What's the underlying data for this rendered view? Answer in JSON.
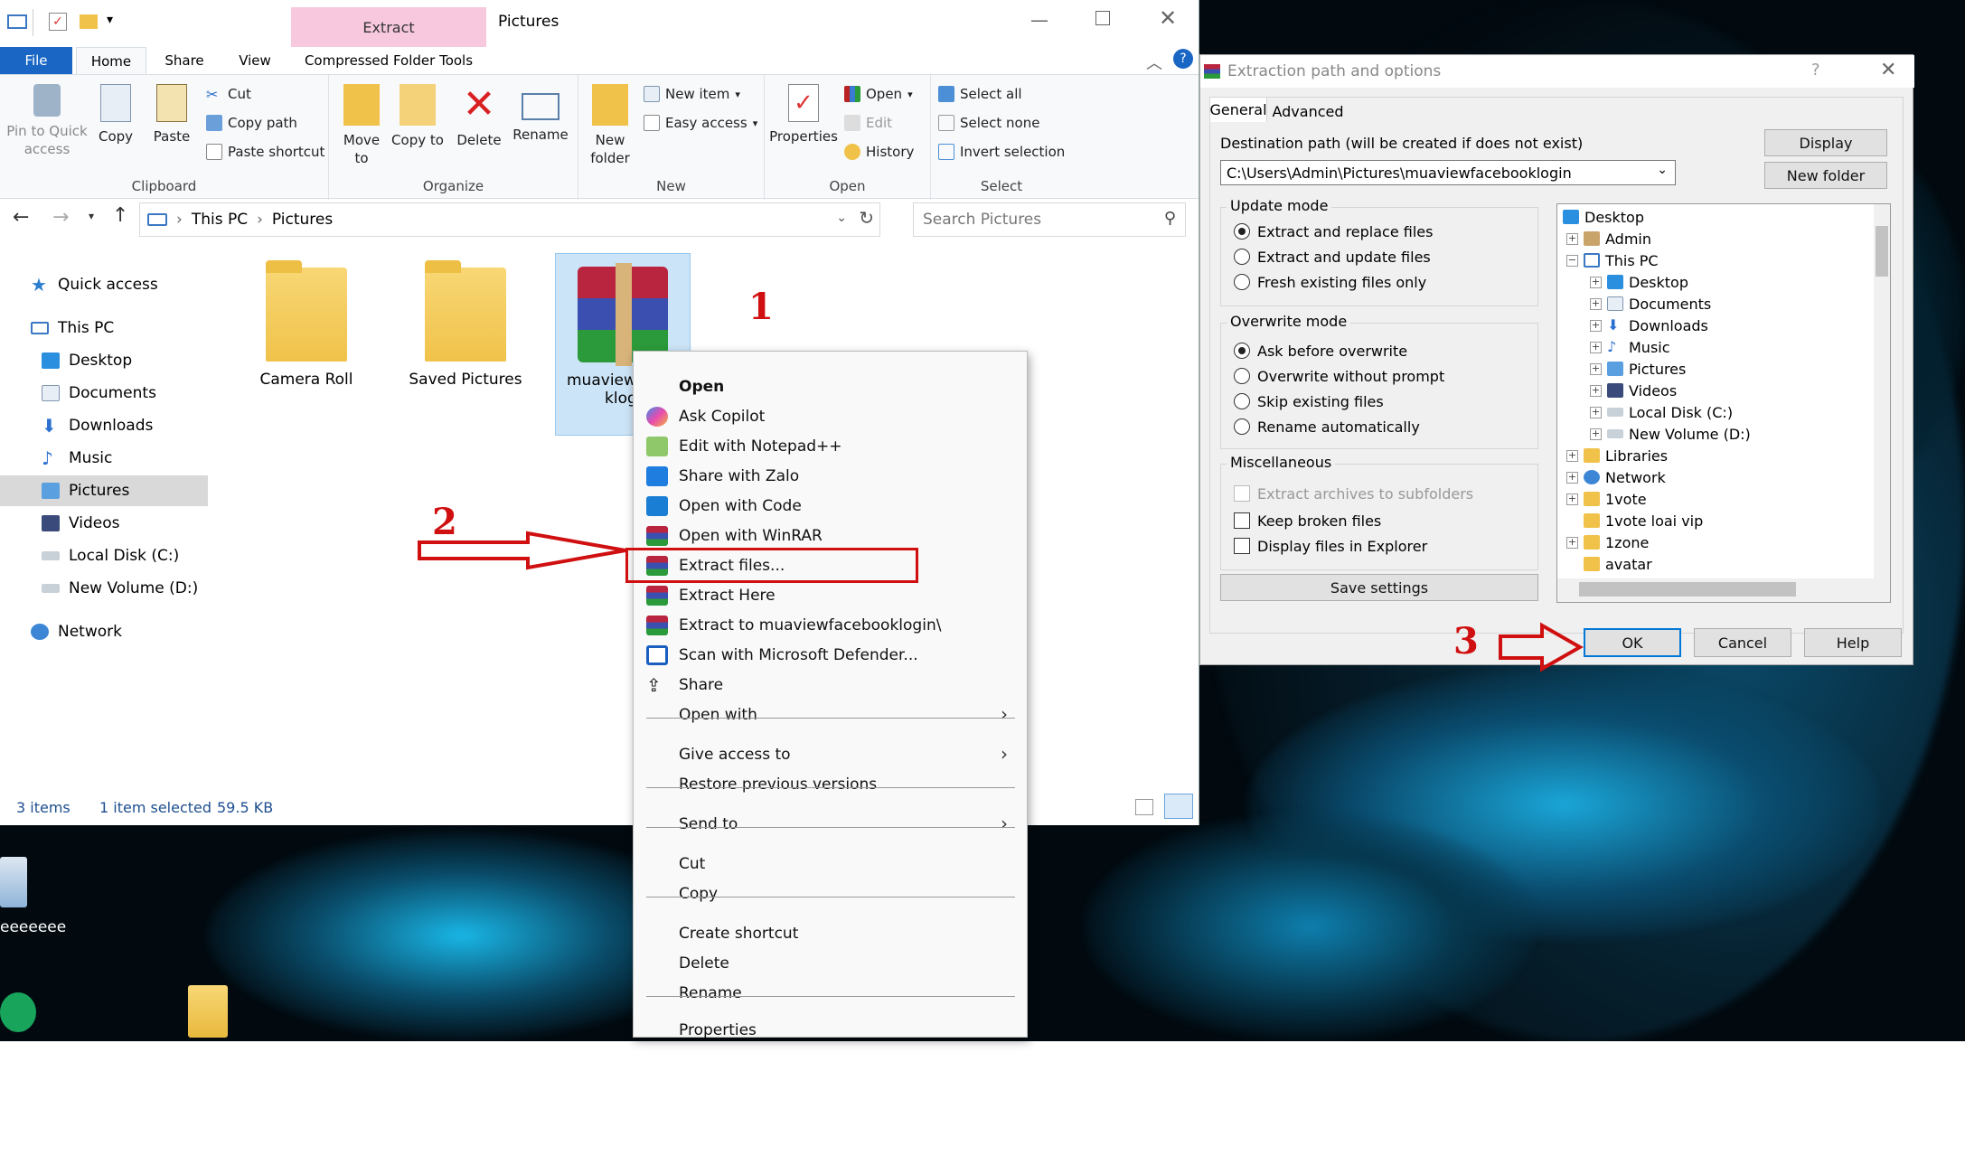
{
  "explorer": {
    "extract_tab": "Extract",
    "window_title": "Pictures",
    "tabs": [
      "File",
      "Home",
      "Share",
      "View",
      "Compressed Folder Tools"
    ],
    "clipboard": {
      "pin": "Pin to Quick access",
      "copy": "Copy",
      "paste": "Paste",
      "cut": "Cut",
      "copy_path": "Copy path",
      "paste_shortcut": "Paste shortcut",
      "label": "Clipboard"
    },
    "organize": {
      "move_to": "Move to",
      "copy_to": "Copy to",
      "delete": "Delete",
      "rename": "Rename",
      "label": "Organize"
    },
    "new": {
      "new_folder": "New folder",
      "new_item": "New item",
      "easy_access": "Easy access",
      "label": "New"
    },
    "open": {
      "properties": "Properties",
      "open": "Open",
      "edit": "Edit",
      "history": "History",
      "label": "Open"
    },
    "select": {
      "select_all": "Select all",
      "select_none": "Select none",
      "invert": "Invert selection",
      "label": "Select"
    },
    "breadcrumb": [
      "This PC",
      "Pictures"
    ],
    "search_placeholder": "Search Pictures",
    "nav": [
      "Quick access",
      "This PC",
      "Desktop",
      "Documents",
      "Downloads",
      "Music",
      "Pictures",
      "Videos",
      "Local Disk (C:)",
      "New Volume (D:)",
      "Network"
    ],
    "files": [
      "Camera Roll",
      "Saved Pictures",
      "muaviewf",
      "klog"
    ],
    "status": {
      "items": "3 items",
      "selected": "1 item selected",
      "size": "59.5 KB"
    }
  },
  "desktop": {
    "icon_label": "eeeeeee"
  },
  "context_menu": {
    "items": [
      "Open",
      "Ask Copilot",
      "Edit with Notepad++",
      "Share with Zalo",
      "Open with Code",
      "Open with WinRAR",
      "Extract files...",
      "Extract Here",
      "Extract to muaviewfacebooklogin\\",
      "Scan with Microsoft Defender...",
      "Share",
      "Open with",
      "Give access to",
      "Restore previous versions",
      "Send to",
      "Cut",
      "Copy",
      "Create shortcut",
      "Delete",
      "Rename",
      "Properties"
    ]
  },
  "dialog": {
    "title": "Extraction path and options",
    "tabs": [
      "General",
      "Advanced"
    ],
    "dest_label": "Destination path (will be created if does not exist)",
    "dest_value": "C:\\Users\\Admin\\Pictures\\muaviewfacebooklogin",
    "display_btn": "Display",
    "new_folder_btn": "New folder",
    "update_mode": {
      "label": "Update mode",
      "options": [
        "Extract and replace files",
        "Extract and update files",
        "Fresh existing files only"
      ]
    },
    "overwrite_mode": {
      "label": "Overwrite mode",
      "options": [
        "Ask before overwrite",
        "Overwrite without prompt",
        "Skip existing files",
        "Rename automatically"
      ]
    },
    "misc": {
      "label": "Miscellaneous",
      "options": [
        "Extract archives to subfolders",
        "Keep broken files",
        "Display files in Explorer"
      ]
    },
    "save_settings": "Save settings",
    "tree": [
      "Desktop",
      "Admin",
      "This PC",
      "Desktop",
      "Documents",
      "Downloads",
      "Music",
      "Pictures",
      "Videos",
      "Local Disk (C:)",
      "New Volume (D:)",
      "Libraries",
      "Network",
      "1vote",
      "1vote loai vip",
      "1zone",
      "avatar"
    ],
    "ok": "OK",
    "cancel": "Cancel",
    "help": "Help"
  },
  "annotations": [
    "1",
    "2",
    "3"
  ]
}
